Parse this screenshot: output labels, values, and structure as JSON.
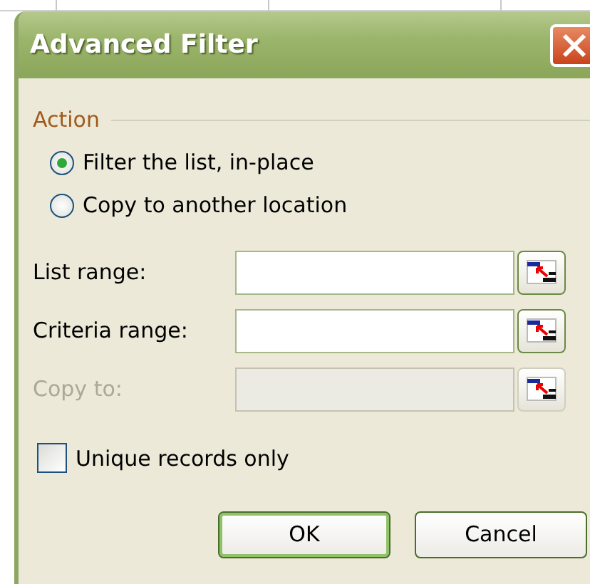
{
  "window": {
    "title": "Advanced Filter"
  },
  "action": {
    "label": "Action",
    "options": [
      {
        "label": "Filter the list, in-place",
        "selected": true
      },
      {
        "label": "Copy to another location",
        "selected": false
      }
    ]
  },
  "fields": [
    {
      "label": "List range:",
      "disabled": false
    },
    {
      "label": "Criteria range:",
      "disabled": false
    },
    {
      "label": "Copy to:",
      "disabled": true
    }
  ],
  "unique_records": {
    "label": "Unique records only",
    "checked": false
  },
  "buttons": [
    {
      "label": "OK",
      "default": true
    },
    {
      "label": "Cancel",
      "default": false
    }
  ]
}
